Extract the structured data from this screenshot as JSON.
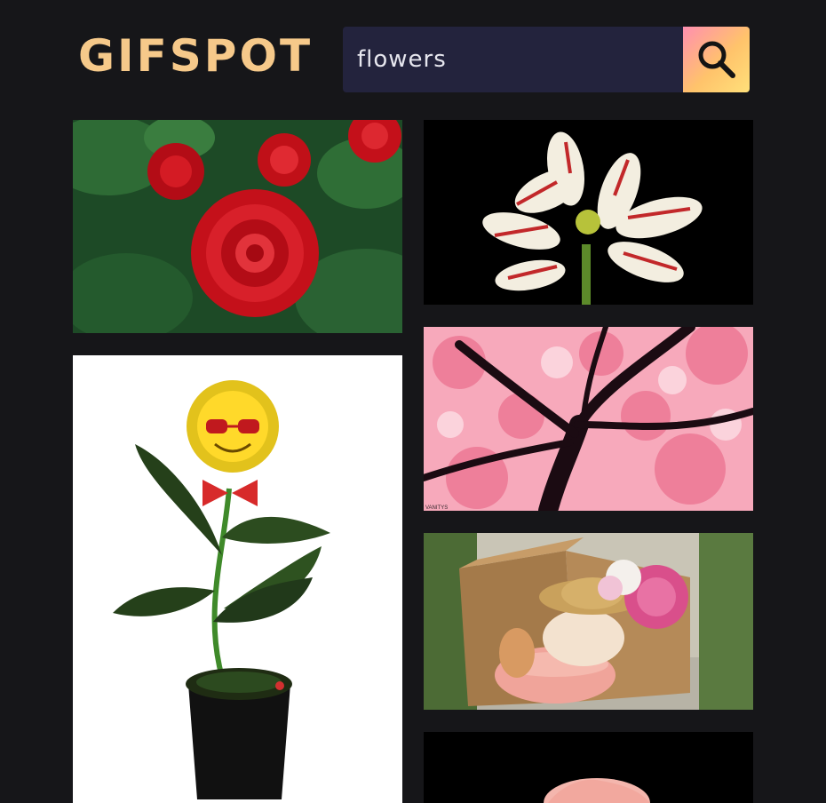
{
  "header": {
    "logo": "GIFSPOT",
    "search": {
      "value": "flowers",
      "button_icon": "search-icon"
    }
  },
  "colors": {
    "background": "#161619",
    "logo": "#f6c98a",
    "search_field": "#23233d",
    "search_button_gradient": [
      "#ff8fb0",
      "#ffc36b",
      "#ffe07a"
    ]
  },
  "results": {
    "left_column": [
      {
        "subject": "red-roses-gif"
      },
      {
        "subject": "dancing-sunflower-sunglasses-gif"
      }
    ],
    "right_column": [
      {
        "subject": "amaryllis-lilies-gif"
      },
      {
        "subject": "cherry-blossom-tree-gif",
        "watermark": "VANITYS"
      },
      {
        "subject": "cat-in-flower-hat-gif"
      },
      {
        "subject": "pink-rose-gif"
      }
    ]
  }
}
